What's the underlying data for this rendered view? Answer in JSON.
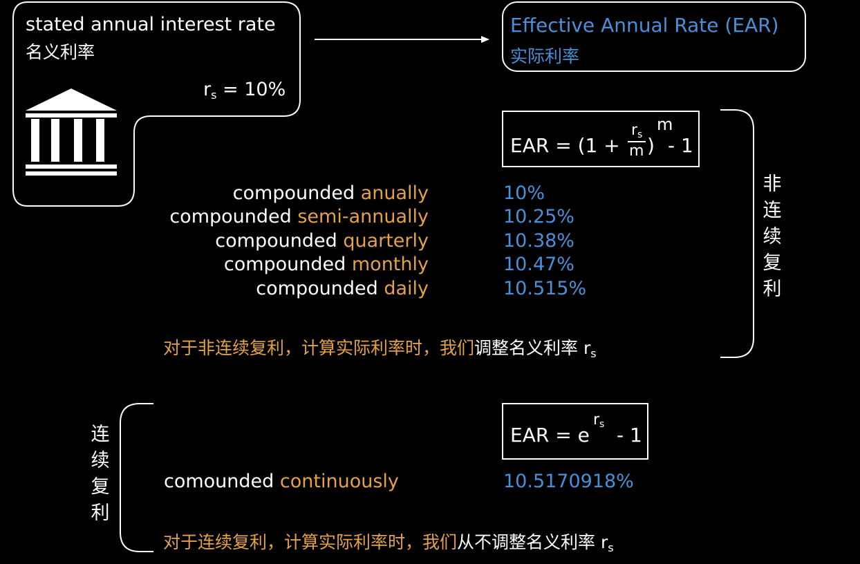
{
  "stated_box": {
    "title_en": "stated annual interest rate",
    "title_cn": "名义利率",
    "rate_symbol": "r",
    "rate_sub": "s",
    "rate_value": "= 10%",
    "icon": "bank-icon"
  },
  "ear_box": {
    "title_en": "Effective Annual Rate (EAR)",
    "title_cn": "实际利率"
  },
  "formula_discrete": {
    "lhs": "EAR = (1 +",
    "num": "r",
    "num_sub": "s",
    "den": "m",
    "close": ")",
    "exp": "m",
    "tail": "- 1"
  },
  "formula_continuous": {
    "lhs": "EAR = e",
    "exp": "r",
    "exp_sub": "s",
    "tail": "- 1"
  },
  "discrete_rows": [
    {
      "prefix": "compounded",
      "frequency": "anually",
      "value": "10%"
    },
    {
      "prefix": "compounded",
      "frequency": "semi-annually",
      "value": "10.25%"
    },
    {
      "prefix": "compounded",
      "frequency": "quarterly",
      "value": "10.38%"
    },
    {
      "prefix": "compounded",
      "frequency": "monthly",
      "value": "10.47%"
    },
    {
      "prefix": "compounded",
      "frequency": "daily",
      "value": "10.515%"
    }
  ],
  "continuous_row": {
    "prefix": "comounded",
    "frequency": "continuously",
    "value": "10.5170918%"
  },
  "bracket_right_label": [
    "非",
    "连",
    "续",
    "复",
    "利"
  ],
  "bracket_left_label": [
    "连",
    "续",
    "复",
    "利"
  ],
  "note_discrete": {
    "orange": "对于非连续复利，计算实际利率时，我们",
    "white": "调整名义利率 r",
    "sub": "s"
  },
  "note_continuous": {
    "orange": "对于连续复利，计算实际利率时，我们",
    "white": "从不调整名义利率 r",
    "sub": "s"
  },
  "colors": {
    "background": "#000000",
    "text": "#ffffff",
    "accent_orange": "#e3a245",
    "accent_blue": "#4a90d9"
  }
}
